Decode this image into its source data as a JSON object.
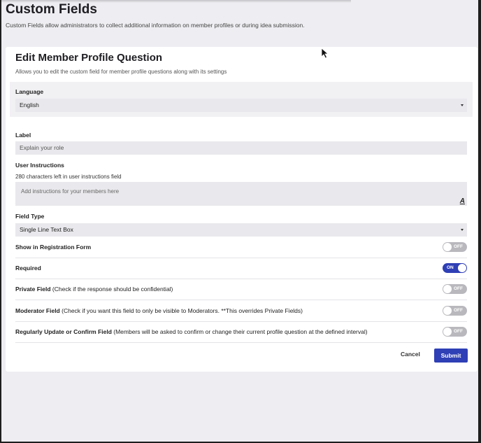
{
  "page": {
    "title": "Custom Fields",
    "description": "Custom Fields allow administrators to collect additional information on member profiles or during idea submission."
  },
  "card": {
    "title": "Edit Member Profile Question",
    "subtitle": "Allows you to edit the custom field for member profile questions along with its settings"
  },
  "language": {
    "label": "Language",
    "value": "English"
  },
  "label_field": {
    "label": "Label",
    "value": "Explain your role"
  },
  "instructions": {
    "label": "User Instructions",
    "helper": "280 characters left in user instructions field",
    "placeholder": "Add instructions for your members here",
    "format_icon": "A"
  },
  "field_type": {
    "label": "Field Type",
    "value": "Single Line Text Box"
  },
  "toggles": [
    {
      "label": "Show in Registration Form",
      "note": "",
      "state": "OFF",
      "on": false
    },
    {
      "label": "Required",
      "note": "",
      "state": "ON",
      "on": true
    },
    {
      "label": "Private Field",
      "note": " (Check if the response should be confidential)",
      "state": "OFF",
      "on": false
    },
    {
      "label": "Moderator Field",
      "note": " (Check if you want this field to only be visible to Moderators. **This overrides Private Fields)",
      "state": "OFF",
      "on": false
    },
    {
      "label": "Regularly Update or Confirm Field",
      "note": " (Members will be asked to confirm or change their current profile question at the defined interval)",
      "state": "OFF",
      "on": false
    }
  ],
  "actions": {
    "cancel": "Cancel",
    "submit": "Submit"
  },
  "colors": {
    "accent": "#2f3fb5",
    "toggle_off": "#b9b8bd",
    "background": "#eeedf1"
  }
}
